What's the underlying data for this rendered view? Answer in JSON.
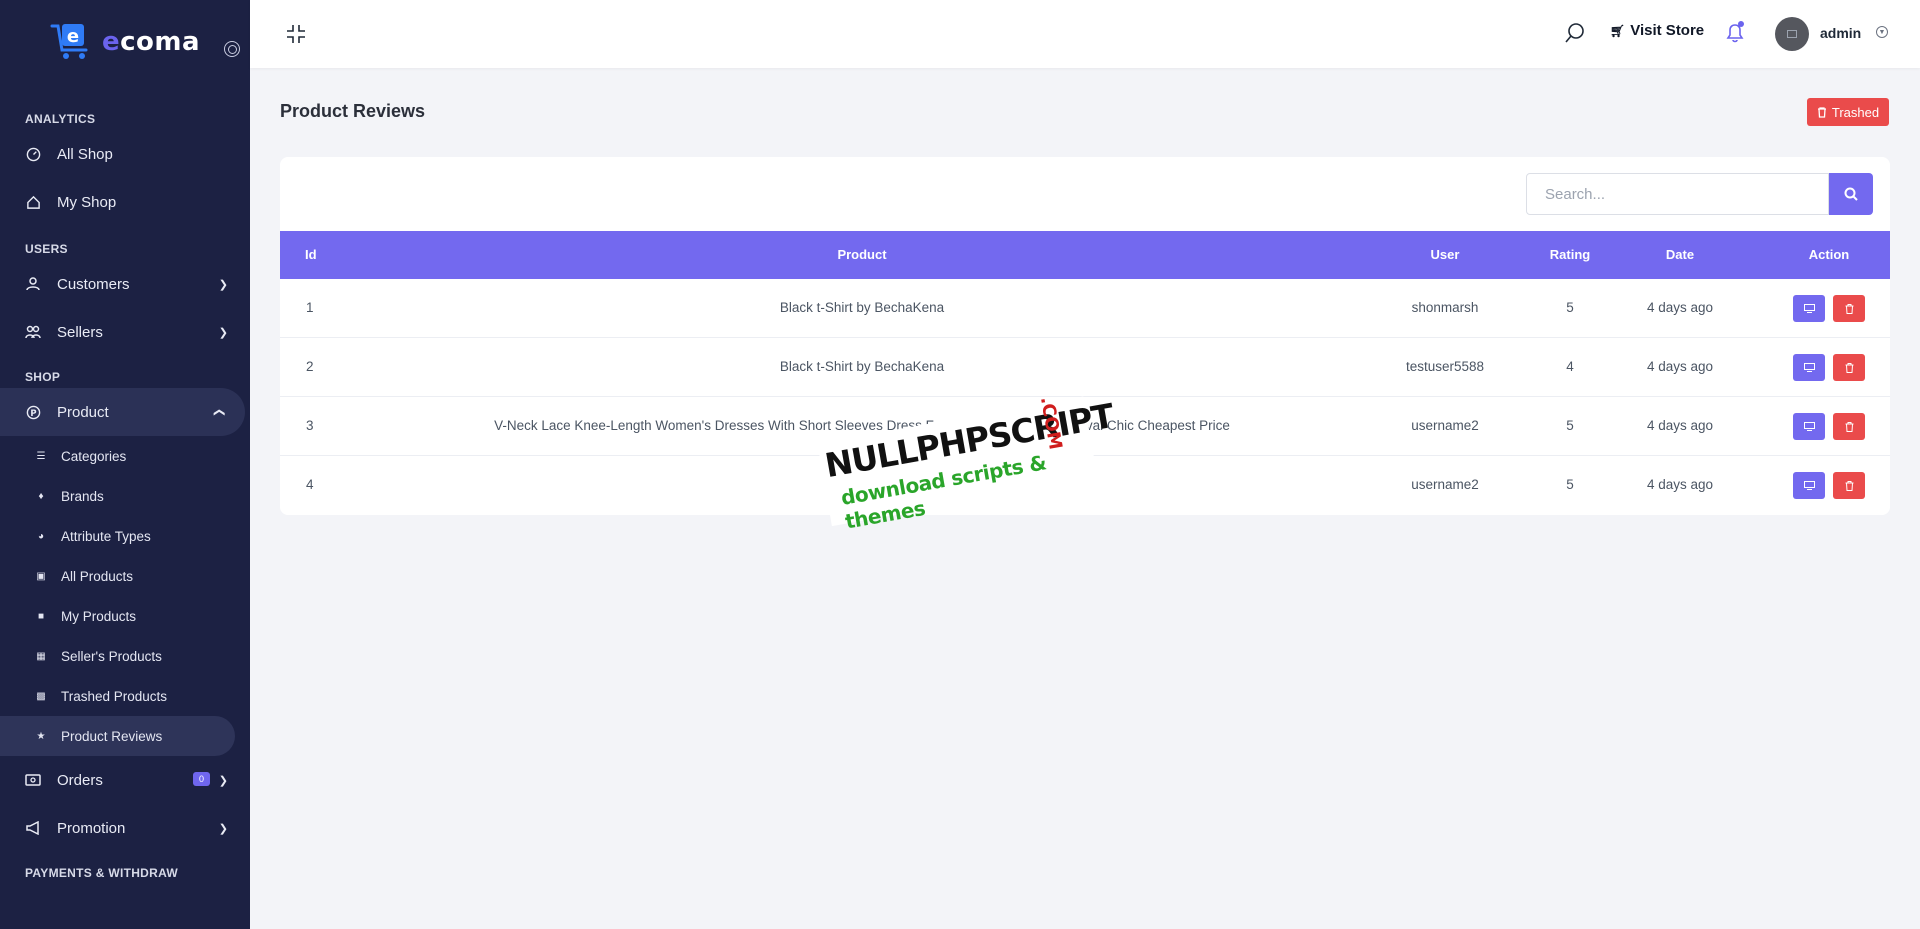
{
  "brand": {
    "name_prefix": "e",
    "name_rest": "coma",
    "logo_letter": "e"
  },
  "sidebar": {
    "sections": {
      "analytics": "ANALYTICS",
      "users": "USERS",
      "shop": "SHOP",
      "payments": "PAYMENTS & WITHDRAW"
    },
    "all_shop": "All Shop",
    "my_shop": "My Shop",
    "customers": "Customers",
    "sellers": "Sellers",
    "product": "Product",
    "sub": {
      "categories": "Categories",
      "brands": "Brands",
      "attribute_types": "Attribute Types",
      "all_products": "All Products",
      "my_products": "My Products",
      "sellers_products": "Seller's Products",
      "trashed_products": "Trashed Products",
      "product_reviews": "Product Reviews"
    },
    "orders": "Orders",
    "orders_badge": "0",
    "promotion": "Promotion"
  },
  "topbar": {
    "visit_store": "Visit Store",
    "admin_name": "admin"
  },
  "page": {
    "title": "Product Reviews",
    "trashed_label": "Trashed",
    "search_placeholder": "Search..."
  },
  "table": {
    "headers": {
      "id": "Id",
      "product": "Product",
      "user": "User",
      "rating": "Rating",
      "date": "Date",
      "action": "Action"
    },
    "rows": [
      {
        "id": "1",
        "product": "Black t-Shirt by BechaKena",
        "user": "shonmarsh",
        "rating": "5",
        "date": "4 days ago"
      },
      {
        "id": "2",
        "product": "Black t-Shirt by BechaKena",
        "user": "testuser5588",
        "rating": "4",
        "date": "4 days ago"
      },
      {
        "id": "3",
        "product": "V-Neck Lace Knee-Length Women's Dresses With Short Sleeves Dress For Women D... s New Arrival Chic Cheapest Price",
        "user": "username2",
        "rating": "5",
        "date": "4 days ago"
      },
      {
        "id": "4",
        "product": "Black t-",
        "user": "username2",
        "rating": "5",
        "date": "4 days ago"
      }
    ]
  },
  "watermark": {
    "main": "NULLPHPSCRIPT",
    "tld": ".COM",
    "sub": "download scripts & themes"
  },
  "colors": {
    "sidebar": "#1c2143",
    "accent": "#7369ef",
    "danger": "#ea4b4b"
  }
}
